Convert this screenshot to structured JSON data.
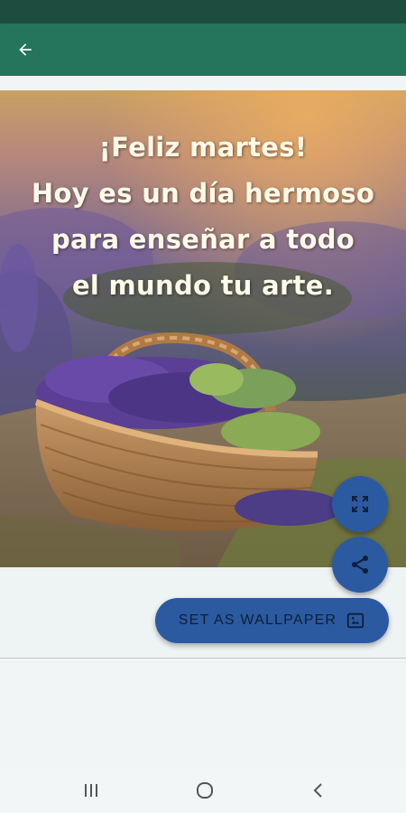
{
  "status_bar": {},
  "app_bar": {
    "back_icon": "arrow-back-icon"
  },
  "image_card": {
    "greeting_lines": [
      "¡Feliz martes!",
      "Hoy es un día hermoso",
      "para enseñar a todo",
      "el mundo tu arte."
    ]
  },
  "actions": {
    "fullscreen_icon": "fullscreen-icon",
    "share_icon": "share-icon",
    "wallpaper_label": "SET AS WALLPAPER",
    "wallpaper_icon": "wallpaper-icon"
  },
  "nav_bar": {
    "recents_icon": "recents-icon",
    "home_icon": "home-icon",
    "back_icon": "back-icon"
  },
  "colors": {
    "status_bar": "#1d4d3f",
    "app_bar": "#25745c",
    "fab": "#2c5aa0",
    "background": "#f1f5f6"
  }
}
